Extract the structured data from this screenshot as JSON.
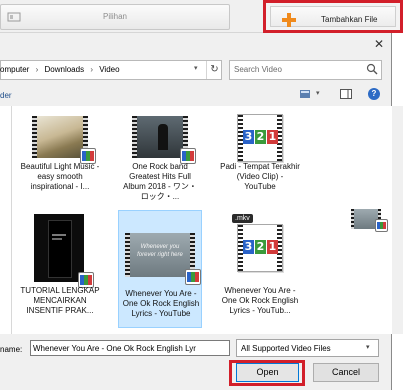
{
  "toolbar": {
    "options_label": "Pilihan",
    "add_file_label": "Tambahkan File"
  },
  "address": {
    "segments": [
      "omputer",
      "›",
      "Downloads",
      "›",
      "Video"
    ],
    "search_placeholder": "Search Video"
  },
  "command_bar": {
    "new_folder_label": "der"
  },
  "files": [
    {
      "caption": "Beautiful Light Music - easy smooth inspirational - I...",
      "thumb": "beach-sunset",
      "selected": false
    },
    {
      "caption": "One Rock band Greatest Hits Full Album 2018 - ワン・ロック・...",
      "thumb": "concert",
      "selected": false
    },
    {
      "caption": "Padi - Tempat Terakhir (Video Clip) - YouTube",
      "thumb": "mpc-file",
      "selected": false
    },
    {
      "caption": "TUTORIAL LENGKAP MENCAIRKAN INSENTIF PRAK...",
      "thumb": "dark-phone",
      "selected": false
    },
    {
      "caption": "Whenever You Are - One Ok Rock English Lyrics - YouTube",
      "thumb": "lyrics-frame",
      "selected": true
    },
    {
      "caption": "Whenever You Are - One Ok Rock English Lyrics - YouTub...",
      "thumb": "mpc-file",
      "ext": ".mkv",
      "selected": false
    }
  ],
  "mpc_digits": [
    "3",
    "2",
    "1"
  ],
  "lyrics_overlay": "Whenever you forever right here",
  "footer": {
    "name_label": "name:",
    "file_name_value": "Whenever You Are - One Ok Rock English Lyr",
    "file_type_value": "All Supported Video Files",
    "open_label": "Open",
    "cancel_label": "Cancel"
  },
  "colors": {
    "highlight_border": "#d21f2a",
    "selection_bg": "#cce8ff",
    "add_icon": "#f08a1c"
  }
}
